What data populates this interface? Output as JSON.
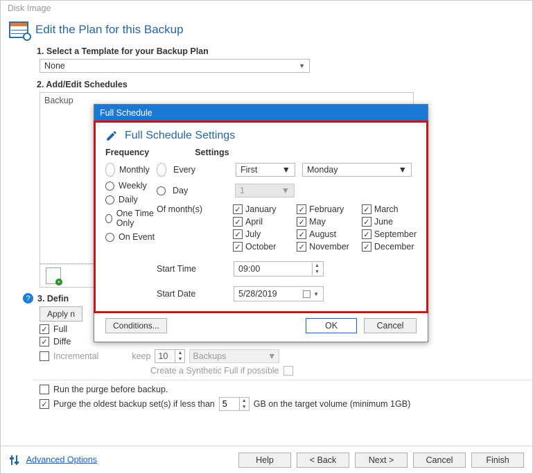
{
  "window": {
    "title": "Disk Image"
  },
  "header": {
    "title": "Edit the Plan for this Backup"
  },
  "step1": {
    "label": "1. Select a Template for your Backup Plan",
    "template": "None"
  },
  "step2": {
    "label": "2. Add/Edit Schedules",
    "list_first": "Backup"
  },
  "step3": {
    "label": "3. Defin",
    "apply_btn": "Apply n",
    "full": "Full ",
    "diff": "Diffe",
    "incremental": "Incremental",
    "keep": "keep",
    "keep_n": "10",
    "keep_unit": "Backups",
    "synth": "Create a Synthetic Full if possible"
  },
  "purge": {
    "before": "Run the purge before backup.",
    "oldest": "Purge the oldest backup set(s) if less than",
    "gb_value": "5",
    "gb_suffix": "GB on the target volume (minimum 1GB)"
  },
  "advanced": "Advanced Options",
  "footer": {
    "help": "Help",
    "back": "< Back",
    "next": "Next >",
    "cancel": "Cancel",
    "finish": "Finish"
  },
  "modal": {
    "title": "Full Schedule",
    "heading": "Full Schedule Settings",
    "cols": {
      "freq": "Frequency",
      "settings": "Settings"
    },
    "freq": [
      "Monthly",
      "Weekly",
      "Daily",
      "One Time Only",
      "On Event"
    ],
    "freq_selected": "Monthly",
    "every": "Every",
    "day_label": "Day",
    "ordinal": "First",
    "weekday": "Monday",
    "day_num": "1",
    "of_months": "Of month(s)",
    "months": [
      "January",
      "February",
      "March",
      "April",
      "May",
      "June",
      "July",
      "August",
      "September",
      "October",
      "November",
      "December"
    ],
    "start_time_label": "Start Time",
    "start_time": "09:00",
    "start_date_label": "Start Date",
    "start_date": "5/28/2019",
    "conditions": "Conditions...",
    "ok": "OK",
    "cancel": "Cancel"
  }
}
